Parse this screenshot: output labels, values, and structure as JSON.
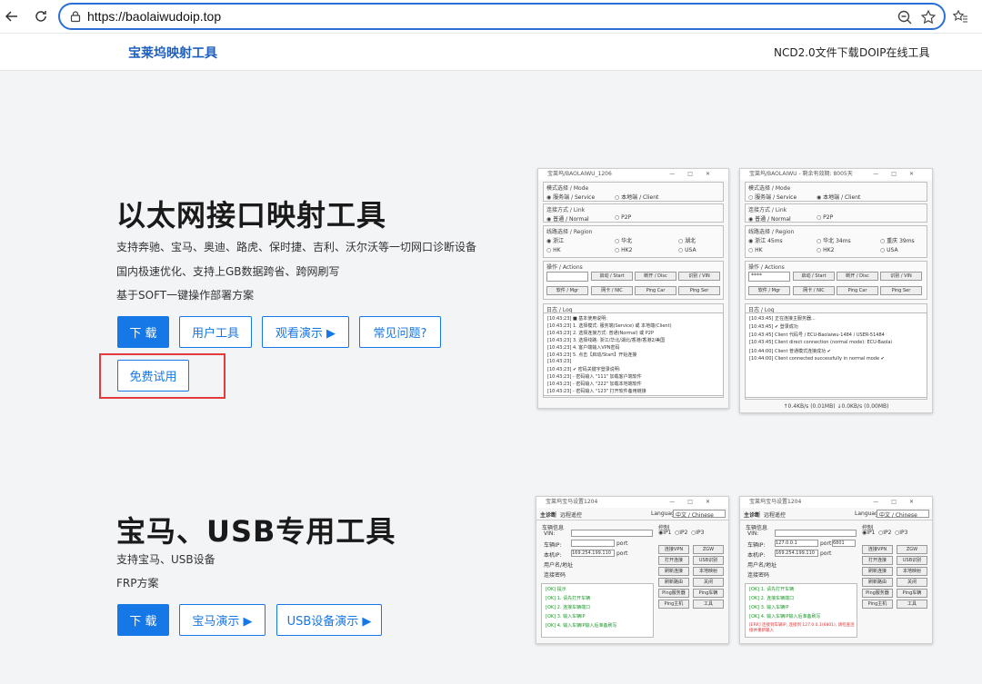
{
  "browser": {
    "url": "https://baolaiwudoip.top"
  },
  "header": {
    "brand": "宝莱坞映射工具",
    "nav": [
      "NCD2.0文件下载",
      "DOIP在线工具"
    ]
  },
  "section1": {
    "title": "以太网接口映射工具",
    "lines": [
      "支持奔驰、宝马、奥迪、路虎、保时捷、吉利、沃尔沃等一切网口诊断设备",
      "国内极速优化、支持上GB数据跨省、跨网刷写",
      "基于SOFT一键操作部署方案"
    ],
    "buttons": {
      "download": "下 载",
      "user_tool": "用户工具",
      "demo": "观看演示 ▶",
      "faq": "常见问题?",
      "trial": "免费试用"
    }
  },
  "section2": {
    "title": "宝马、USB专用工具",
    "lines": [
      "支持宝马、USB设备",
      "FRP方案"
    ],
    "buttons": {
      "download": "下 载",
      "bmw_demo": "宝马演示 ▶",
      "usb_demo": "USB设备演示 ▶"
    }
  },
  "win_left": {
    "title": "宝莱坞/BAOLAIWU_1206",
    "mode_label": "模式选择 / Mode",
    "mode_opts": [
      "服务端 / Service",
      "本地端 / Client"
    ],
    "link_label": "连接方式 / Link",
    "link_opts": [
      "普通 / Normal",
      "P2P"
    ],
    "region_label": "线路选择 / Region",
    "regions": [
      "浙江",
      "华北",
      "湖北",
      "HK",
      "HK2",
      "USA"
    ],
    "ops_label": "操作 / Actions",
    "ops": [
      "启动 / Start",
      "断开 / Disc",
      "识别 / VIN",
      "软件 / Mgr",
      "网卡 / NIC",
      "Ping Car",
      "Ping Ser"
    ],
    "log_label": "日志 / Log",
    "logs": [
      "[10:43:23] ■ 基本使用说明:",
      "[10:43:23] 1. 选择模式: 服务端(Service) 或 本地端(Client)",
      "[10:43:23] 2. 选择连接方式: 普通(Normal) 或 P2P",
      "[10:43:23] 3. 选择线路: 浙江/华北/湖北/香港/香港2/美国",
      "[10:43:23] 4. 客户端输入VPN密码",
      "[10:43:23] 5. 点击【启动/Start】开始连接",
      "[10:43:23]",
      "[10:43:23] ✔ 密码关键字登录说明:",
      "[10:43:23] - 密码输入 \"111\" 加载客户端软件",
      "[10:43:23] - 密码输入 \"222\" 加载本地端软件",
      "[10:43:23] - 密码输入 \"123\" 打开软件备用链接"
    ]
  },
  "win_right": {
    "title": "宝莱坞/BAOLAIWU - 剩余有效期: 8005天",
    "mode_label": "模式选择 / Mode",
    "mode_opts": [
      "服务端 / Service",
      "本地端 / Client"
    ],
    "link_label": "连接方式 / Link",
    "link_opts": [
      "普通 / Normal",
      "P2P"
    ],
    "region_label": "线路选择 / Region",
    "regions": [
      "浙江 45ms",
      "华北 34ms",
      "重庆 39ms",
      "HK",
      "HK2",
      "USA"
    ],
    "ops_label": "操作 / Actions",
    "pw": "****",
    "ops": [
      "启动 / Start",
      "断开 / Disc",
      "识别 / VIN",
      "软件 / Mgr",
      "网卡 / NIC",
      "Ping Car",
      "Ping Ser"
    ],
    "log_label": "日志 / Log",
    "logs": [
      "[10:43:45] 正在连接主服务器...",
      "[10:43:45] ✔ 登录成功",
      "[10:43:45] Client 代码号 / ECU-Baolaiwu-1484 / USER-51484",
      "[10:43:45] Client direct connection (normal mode): ECU-Baolai",
      "[10:44:00] Client 普通模式连接成功 ✔",
      "[10:44:00] Client connected successfully in normal mode ✔"
    ],
    "status": "↑0.4KB/s (0.01MB)  ↓0.0KB/s (0.00MB)"
  },
  "bmw_win_left": {
    "title": "宝莱坞宝马设置1204",
    "tabs": [
      "主诊断",
      "远程遥控"
    ],
    "lang_label": "Language:",
    "lang": "中文 / Chinese",
    "fields": [
      "车辆信息",
      "VIN:",
      "车辆IP:",
      "本机IP:",
      "用户名/地址",
      "连接密码"
    ],
    "ip": "169.254.199.110",
    "port_label": "port",
    "btns": [
      "连接VPN",
      "ZGW",
      "打开连接",
      "USB识别",
      "刷新连接",
      "本地映射",
      "刷新路由",
      "关闭",
      "Ping服务器",
      "Ping车辆",
      "Ping主机",
      "工具"
    ],
    "ctrl_label": "控制",
    "ip_opts": [
      "IP1",
      "IP2",
      "IP3"
    ],
    "logs": [
      "[OK] 提示",
      "[OK] 1. 请先打开车辆",
      "[OK] 2. 连接车辆端口",
      "[OK] 3. 输入车辆IP",
      "[OK] 4. 输入车辆IP输入后准备刷写"
    ]
  },
  "bmw_win_right": {
    "title": "宝莱坞宝马设置1204",
    "tabs": [
      "主诊断",
      "远程遥控"
    ],
    "lang_label": "Language:",
    "lang": "中文 / Chinese",
    "fields": [
      "车辆信息",
      "VIN:",
      "车辆IP:",
      "本机IP:",
      "用户名/地址",
      "连接密码"
    ],
    "vehicle_ip": "127.0.0.1",
    "ip": "169.254.199.110",
    "port_label": "port",
    "port_val": "6801",
    "btns": [
      "连接VPN",
      "ZGW",
      "打开连接",
      "USB识别",
      "刷新连接",
      "本地映射",
      "刷新路由",
      "关闭",
      "Ping服务器",
      "Ping车辆",
      "Ping主机",
      "工具"
    ],
    "ctrl_label": "控制",
    "ip_opts": [
      "IP1",
      "IP2",
      "IP3"
    ],
    "logs": [
      "[OK] 1. 请先打开车辆",
      "[OK] 2. 连接车辆端口",
      "[OK] 3. 输入车辆IP",
      "[OK] 4. 输入车辆IP输入后准备刷写"
    ],
    "error": "[ERR] 连接到车辆IP, 连接到 127.0.0.1(6801), 请检查连接并重新输入"
  }
}
